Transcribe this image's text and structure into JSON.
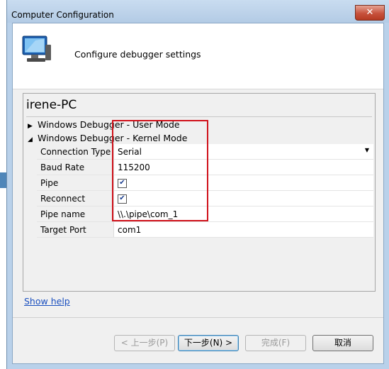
{
  "window": {
    "title": "Computer Configuration",
    "close_glyph": "✕"
  },
  "header": {
    "heading": "Configure debugger settings",
    "icon": "computer-monitor-icon"
  },
  "panel": {
    "computer_name": "irene-PC",
    "nodes": [
      {
        "label": "Windows Debugger - User Mode",
        "expanded": false
      },
      {
        "label": "Windows Debugger - Kernel Mode",
        "expanded": true
      }
    ],
    "properties": [
      {
        "name": "Connection Type",
        "value": "Serial",
        "type": "dropdown"
      },
      {
        "name": "Baud Rate",
        "value": "115200",
        "type": "text"
      },
      {
        "name": "Pipe",
        "checked": true,
        "type": "checkbox"
      },
      {
        "name": "Reconnect",
        "checked": true,
        "type": "checkbox"
      },
      {
        "name": "Pipe name",
        "value": "\\\\.\\pipe\\com_1",
        "type": "text"
      },
      {
        "name": "Target Port",
        "value": "com1",
        "type": "text"
      }
    ]
  },
  "show_help": "Show help",
  "buttons": {
    "back": "< 上一步(P)",
    "next": "下一步(N) >",
    "finish": "完成(F)",
    "cancel": "取消"
  },
  "colors": {
    "highlight": "#d0121b",
    "link": "#1a4fbf"
  }
}
